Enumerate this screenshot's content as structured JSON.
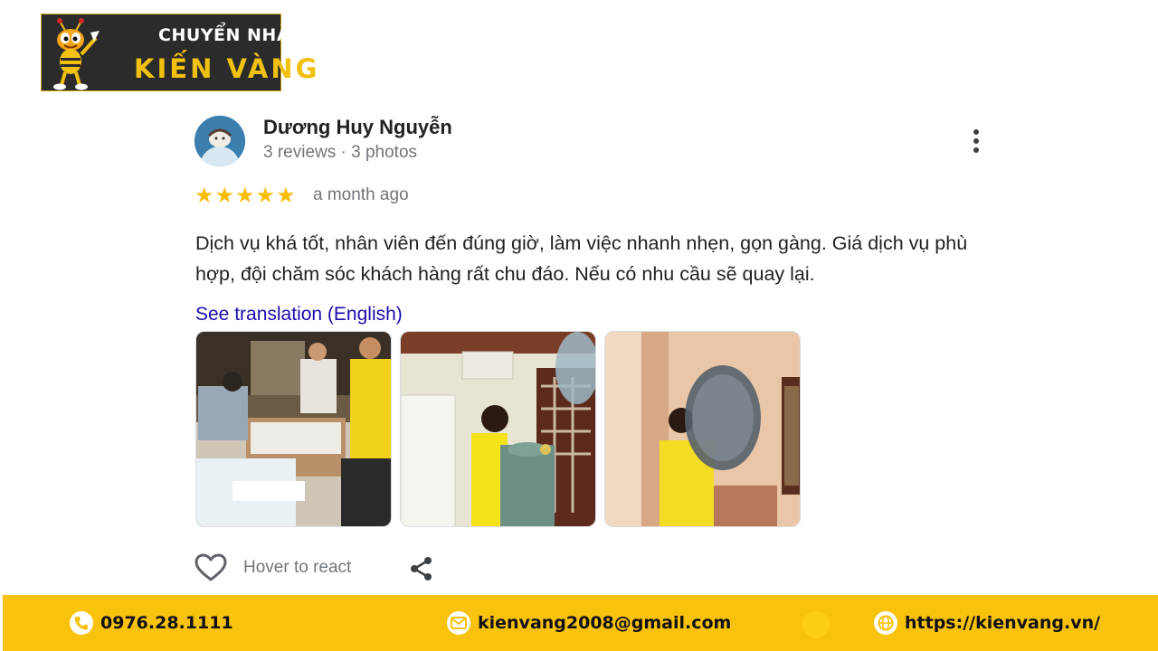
{
  "logo": {
    "line1": "CHUYỂN NHÀ",
    "line2": "KIẾN VÀNG"
  },
  "review": {
    "author_name": "Dương Huy Nguyễn",
    "author_meta": "3 reviews · 3 photos",
    "rating": 5,
    "rating_max": 5,
    "date": "a month ago",
    "text": "Dịch vụ khá tốt, nhân viên đến đúng giờ, làm việc nhanh nhẹn, gọn gàng. Giá dịch vụ phù hợp, đội chăm sóc khách hàng rất chu đáo. Nếu có nhu cầu sẽ quay lại.",
    "translate_link": "See translation (English)",
    "react_label": "Hover to react",
    "icons": {
      "menu": "more-vertical-icon",
      "star": "star-icon",
      "react": "heart-icon",
      "share": "share-icon"
    }
  },
  "footer": {
    "phone": "0976.28.1111",
    "email": "kienvang2008@gmail.com",
    "website": "https://kienvang.vn/",
    "icons": [
      "phone-icon",
      "email-icon",
      "globe-icon"
    ]
  },
  "colors": {
    "brand_yellow": "#f9c20c",
    "star": "#fbbc04",
    "link": "#1a0dab",
    "logo_bg": "#2b2b2b"
  }
}
